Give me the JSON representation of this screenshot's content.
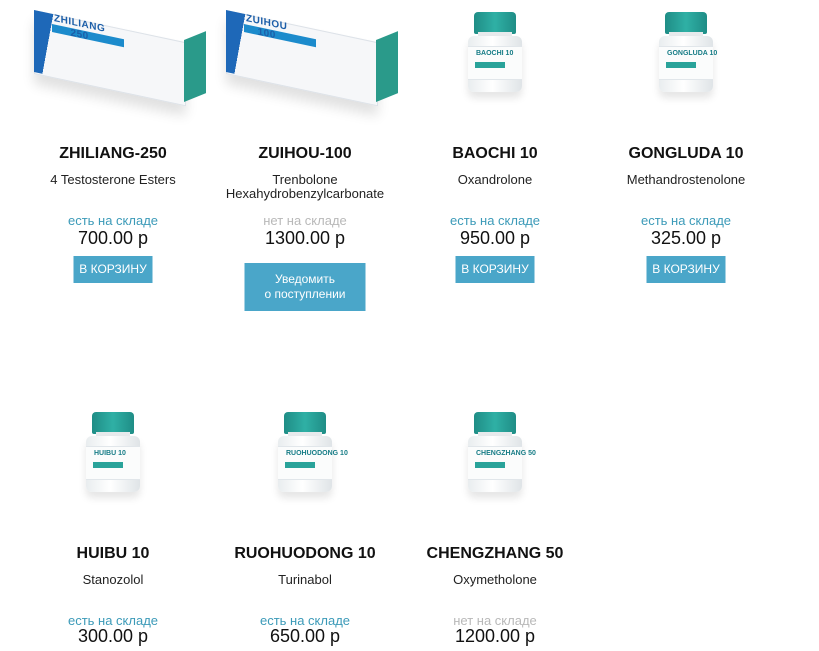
{
  "products": [
    {
      "name": "ZHILIANG-250",
      "sub1": "4 Testosterone Esters",
      "sub2": "",
      "stock": "есть на складе",
      "price": "700.00 р",
      "button": "В КОРЗИНУ",
      "image_label": "ZHILIANG 250",
      "image": "box"
    },
    {
      "name": "ZUIHOU-100",
      "sub1": "Trenbolone",
      "sub2": "Hexahydrobenzylcarbonate",
      "stock": "нет на складе",
      "price": "1300.00 р",
      "button_line1": "Уведомить",
      "button_line2": "о поступлении",
      "image_label": "ZUIHOU 100",
      "image": "box"
    },
    {
      "name": "BAOCHI 10",
      "sub1": "Oxandrolone",
      "sub2": "",
      "stock": "есть на складе",
      "price": "950.00 р",
      "button": "В КОРЗИНУ",
      "image_label": "BAOCHI 10",
      "image": "bottle"
    },
    {
      "name": "GONGLUDA 10",
      "sub1": "Methandrostenolone",
      "sub2": "",
      "stock": "есть на складе",
      "price": "325.00 р",
      "button": "В КОРЗИНУ",
      "image_label": "GONGLUDA 10",
      "image": "bottle"
    },
    {
      "name": "HUIBU 10",
      "sub1": "Stanozolol",
      "sub2": "",
      "stock": "есть на складе",
      "price": "300.00 р",
      "image_label": "HUIBU 10",
      "image": "bottle"
    },
    {
      "name": "RUOHUODONG 10",
      "sub1": "Turinabol",
      "sub2": "",
      "stock": "есть на складе",
      "price": "650.00 р",
      "image_label": "RUOHUODONG 10",
      "image": "bottle"
    },
    {
      "name": "CHENGZHANG 50",
      "sub1": "Oxymetholone",
      "sub2": "",
      "stock": "нет на складе",
      "price": "1200.00 р",
      "image_label": "CHENGZHANG 50",
      "image": "bottle"
    }
  ],
  "colors": {
    "in_stock": "#3b9ab8",
    "out_of_stock": "#b8b8b8",
    "button_bg": "#4aa6c9",
    "bottle_cap": "#2fb0a5",
    "box_blue": "#1e68b8"
  }
}
